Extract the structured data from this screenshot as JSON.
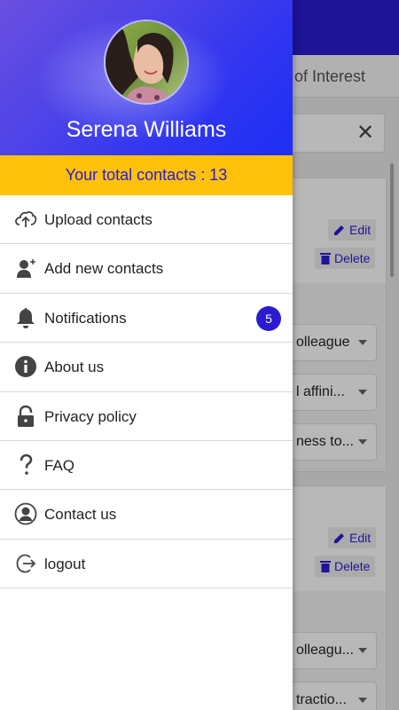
{
  "background": {
    "tab_label": "of Interest",
    "close_icon": "close-icon",
    "cards": [
      {
        "edit_label": "Edit",
        "delete_label": "Delete",
        "dropdowns": [
          "olleague",
          "l affini...",
          "ness to..."
        ]
      },
      {
        "edit_label": "Edit",
        "delete_label": "Delete",
        "dropdowns": [
          "olleagu...",
          "tractio..."
        ]
      }
    ]
  },
  "drawer": {
    "user_name": "Serena Williams",
    "total_contacts": "Your total contacts : 13",
    "menu": [
      {
        "label": "Upload contacts",
        "icon": "cloud-upload-icon"
      },
      {
        "label": "Add new contacts",
        "icon": "add-user-icon"
      },
      {
        "label": "Notifications",
        "icon": "bell-icon",
        "badge": "5"
      },
      {
        "label": "About us",
        "icon": "info-icon"
      },
      {
        "label": "Privacy policy",
        "icon": "lock-icon"
      },
      {
        "label": "FAQ",
        "icon": "question-icon"
      },
      {
        "label": "Contact us",
        "icon": "person-circle-icon"
      },
      {
        "label": "logout",
        "icon": "logout-icon"
      }
    ]
  },
  "colors": {
    "accent": "#2b1bd0",
    "contacts_bar": "#ffc10a"
  }
}
